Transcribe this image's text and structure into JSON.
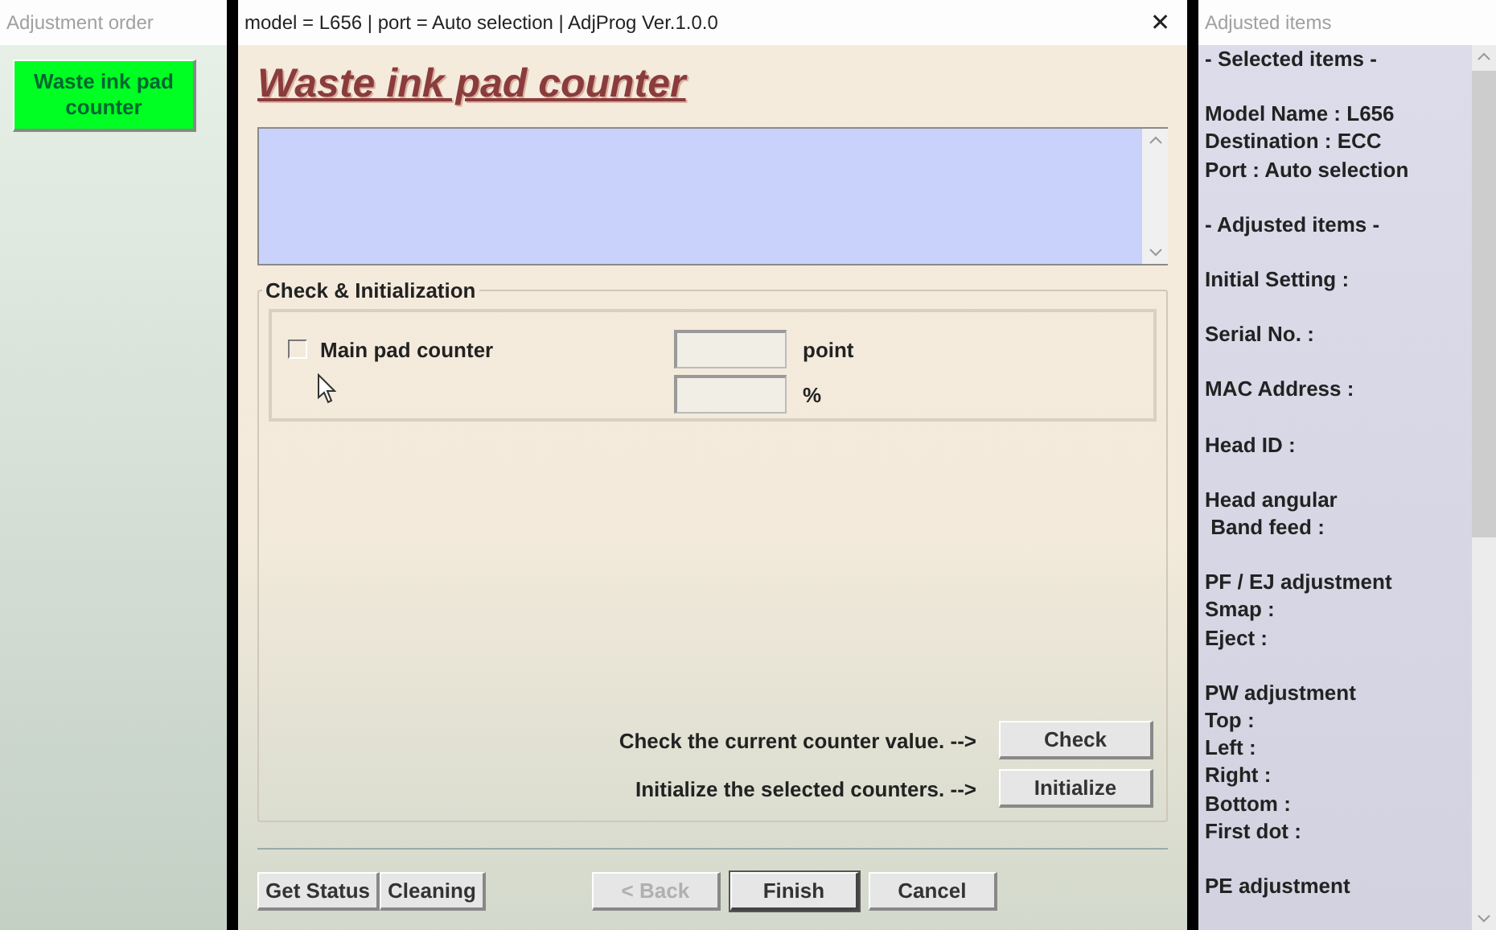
{
  "left_panel": {
    "title": "Adjustment order",
    "items": [
      {
        "label": "Waste ink pad counter",
        "selected": true
      }
    ]
  },
  "dialog": {
    "title": "model = L656 | port = Auto selection | AdjProg Ver.1.0.0",
    "close": "✕",
    "heading": "Waste ink pad counter",
    "group": {
      "title": "Check & Initialization",
      "counters": [
        {
          "label": "Main pad counter",
          "checked": false,
          "unit": "point"
        }
      ],
      "extra_fields": [
        {
          "unit": "%"
        }
      ]
    },
    "actions": [
      {
        "text": "Check the current counter value. -->",
        "button": "Check"
      },
      {
        "text": "Initialize the selected counters. -->",
        "button": "Initialize"
      }
    ],
    "left_buttons": [
      {
        "label": "Get Status",
        "disabled": false
      },
      {
        "label": "Cleaning",
        "disabled": false
      }
    ],
    "nav_buttons": [
      {
        "label": "< Back",
        "disabled": true,
        "default": false
      },
      {
        "label": "Finish",
        "disabled": false,
        "default": true
      },
      {
        "label": "Cancel",
        "disabled": false,
        "default": false
      }
    ]
  },
  "right_panel": {
    "title": "Adjusted items",
    "groups": [
      [
        "- Selected items -"
      ],
      [
        "Model Name : L656",
        "Destination : ECC",
        "Port : Auto selection"
      ],
      [
        "- Adjusted items -"
      ],
      [
        "Initial Setting :"
      ],
      [
        "Serial No. :"
      ],
      [
        "MAC Address :"
      ],
      [
        "Head ID :"
      ],
      [
        "Head angular",
        " Band feed :"
      ],
      [
        "PF / EJ adjustment",
        "Smap :",
        "Eject :"
      ],
      [
        "PW adjustment",
        "Top :",
        "Left :",
        "Right :",
        "Bottom :",
        "First dot :"
      ],
      [
        "PE adjustment"
      ]
    ]
  }
}
